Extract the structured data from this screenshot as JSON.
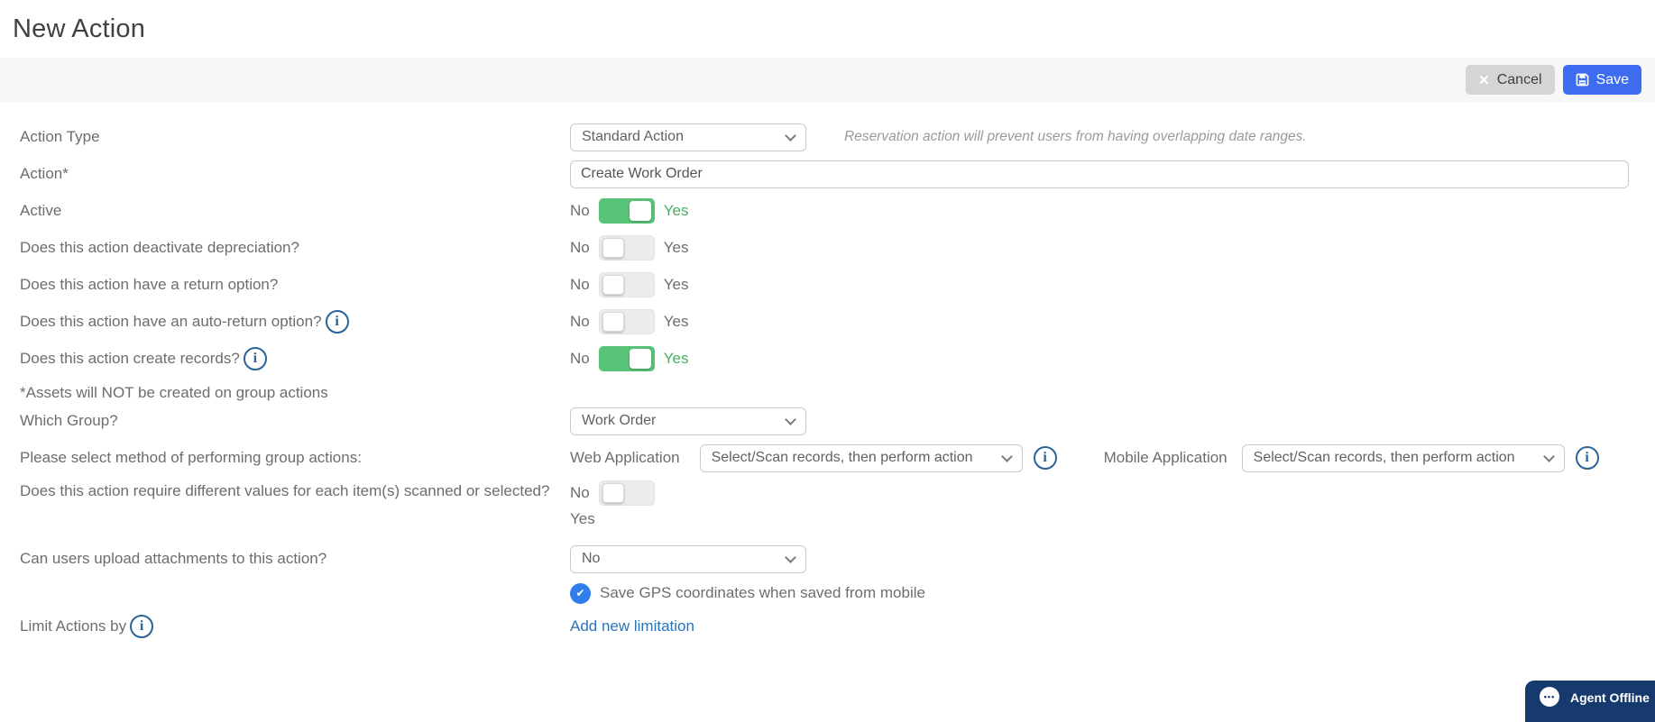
{
  "page": {
    "title": "New Action"
  },
  "toolbar": {
    "cancel_label": "Cancel",
    "save_label": "Save"
  },
  "icons": {
    "close": "✕",
    "info": "i",
    "check": "✔",
    "chat_dots": "•••"
  },
  "form": {
    "toggle_no": "No",
    "toggle_yes": "Yes",
    "action_type": {
      "label": "Action Type",
      "value": "Standard Action",
      "note": "Reservation action will prevent users from having overlapping date ranges."
    },
    "action_name": {
      "label": "Action*",
      "value": "Create Work Order"
    },
    "active": {
      "label": "Active",
      "state": true
    },
    "deactivate_depreciation": {
      "label": "Does this action deactivate depreciation?",
      "state": false
    },
    "return_option": {
      "label": "Does this action have a return option?",
      "state": false
    },
    "auto_return": {
      "label": "Does this action have an auto-return option?",
      "state": false
    },
    "create_records": {
      "label": "Does this action create records?",
      "state": true
    },
    "assets_note": "*Assets will NOT be created on group actions",
    "which_group": {
      "label": "Which Group?",
      "value": "Work Order"
    },
    "group_method": {
      "label": "Please select method of performing group actions:",
      "web_label": "Web Application",
      "web_value": "Select/Scan records, then perform action",
      "mobile_label": "Mobile Application",
      "mobile_value": "Select/Scan records, then perform action"
    },
    "different_values": {
      "label": "Does this action require different values for each item(s) scanned or selected?",
      "state": false
    },
    "upload_attachments": {
      "label": "Can users upload attachments to this action?",
      "value": "No"
    },
    "gps": {
      "label": "Save GPS coordinates when saved from mobile",
      "checked": true
    },
    "add_limitation_link": "Add new limitation",
    "limit_actions": {
      "label": "Limit Actions by"
    }
  },
  "chat_widget": {
    "label": "Agent Offline"
  },
  "colors": {
    "green": "#58c377",
    "green-text": "#47ae63",
    "info-blue": "#2a6496",
    "link-blue": "#2c72b4",
    "save-blue": "#3d6cf0",
    "gps-blue": "#307dec",
    "chat-navy": "#163a6e",
    "label-gray": "#6d6d6d"
  }
}
